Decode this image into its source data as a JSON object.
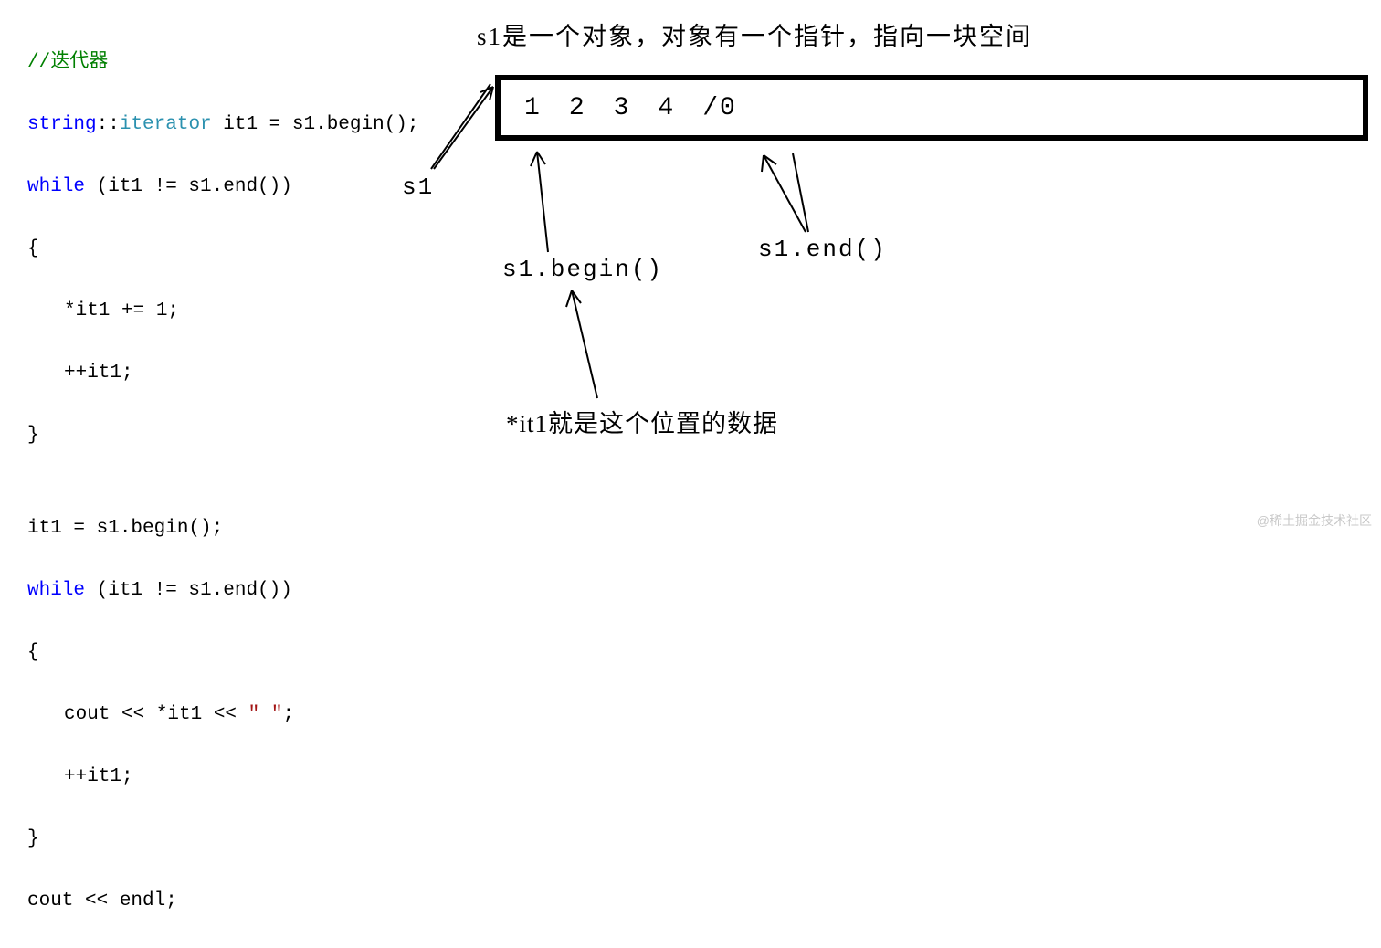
{
  "code": {
    "comment": "//迭代器",
    "line1_type": "string",
    "line1_scope": "::",
    "line1_iter": "iterator",
    "line1_rest": " it1 = s1.begin();",
    "line2_kw": "while",
    "line2_rest": " (it1 != s1.end())",
    "brace_open": "{",
    "line4": "*it1 += 1;",
    "line5": "++it1;",
    "brace_close": "}",
    "blank": "",
    "line8": "it1 = s1.begin();",
    "line9_kw": "while",
    "line9_rest": " (it1 != s1.end())",
    "line11a": "cout << *it1 << ",
    "line11_str": "\" \"",
    "line11b": ";",
    "line14": "cout << endl;"
  },
  "diagram": {
    "caption_top": "s1是一个对象，对象有一个指针，指向一块空间",
    "cell1": "1",
    "cell2": "2",
    "cell3": "3",
    "cell4": "4",
    "cell5": "/0",
    "label_s1": "s1",
    "label_begin": "s1.begin()",
    "label_end": "s1.end()",
    "label_it1_desc": "*it1就是这个位置的数据"
  },
  "watermark": "@稀土掘金技术社区"
}
